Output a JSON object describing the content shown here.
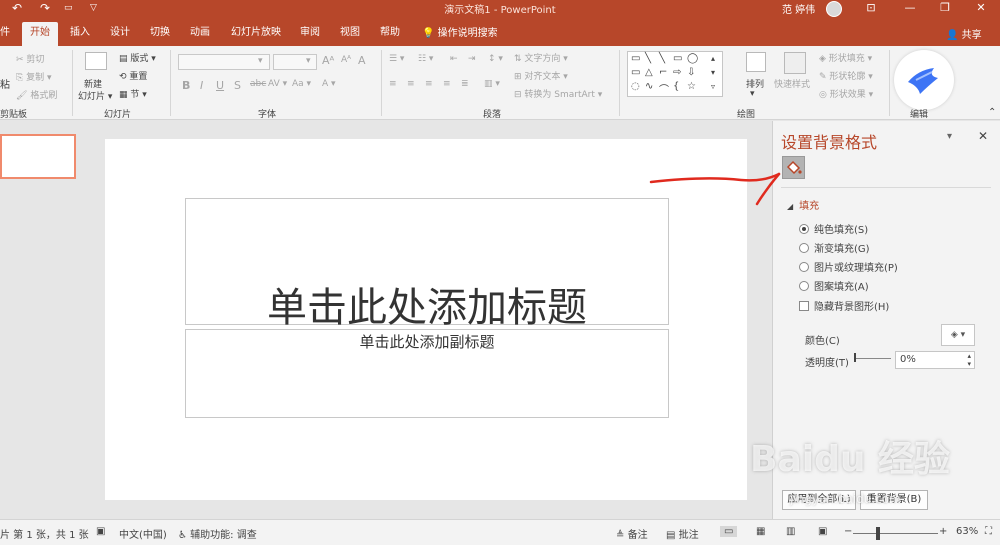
{
  "app": {
    "doc_title": "演示文稿1  -  PowerPoint",
    "user_name": "范 婷伟",
    "colors": {
      "accent": "#b7472a",
      "ribbon_bg": "#f3f3f3",
      "canvas_bg": "#e6e6e6"
    }
  },
  "quick_access": {
    "undo": "↶",
    "redo": "↷"
  },
  "window_controls": {
    "ribbon_display": "⊡",
    "minimize": "—",
    "restore": "❐",
    "close": "✕"
  },
  "tabs": [
    {
      "label": "件"
    },
    {
      "label": "开始"
    },
    {
      "label": "插入"
    },
    {
      "label": "设计"
    },
    {
      "label": "切换"
    },
    {
      "label": "动画"
    },
    {
      "label": "幻灯片放映"
    },
    {
      "label": "审阅"
    },
    {
      "label": "视图"
    },
    {
      "label": "帮助"
    }
  ],
  "search_tab": "操作说明搜索",
  "share_label": "共享",
  "ribbon": {
    "clipboard": {
      "paste": "粘",
      "cut": "剪切",
      "copy": "复制",
      "format_painter": "格式刷",
      "group": "剪贴板"
    },
    "slides": {
      "new_slide_1": "新建",
      "new_slide_2": "幻灯片 ▾",
      "layout": "版式 ▾",
      "reset": "重置",
      "section": "节 ▾",
      "group": "幻灯片"
    },
    "font": {
      "bold": "B",
      "italic": "I",
      "underline": "U",
      "shadow": "S",
      "strike": "abc",
      "spacing": "AV ▾",
      "case": "Aa ▾",
      "color": "A ▾",
      "grow": "Aᴬ",
      "shrink": "Aᴬ",
      "clear": "A",
      "group": "字体"
    },
    "paragraph": {
      "text_direction": "文字方向 ▾",
      "align_text": "对齐文本 ▾",
      "smartart": "转换为 SmartArt ▾",
      "group": "段落"
    },
    "drawing": {
      "arrange": "排列",
      "quick_styles": "快速样式",
      "shape_fill": "形状填充 ▾",
      "shape_outline": "形状轮廓 ▾",
      "shape_effects": "形状效果 ▾",
      "group": "绘图"
    },
    "editing": {
      "group": "编辑"
    }
  },
  "slide": {
    "title_placeholder": "单击此处添加标题",
    "subtitle_placeholder": "单击此处添加副标题"
  },
  "format_pane": {
    "title": "设置背景格式",
    "fill_section": "填充",
    "options": [
      {
        "label": "纯色填充(S)",
        "selected": true
      },
      {
        "label": "渐变填充(G)",
        "selected": false
      },
      {
        "label": "图片或纹理填充(P)",
        "selected": false
      },
      {
        "label": "图案填充(A)",
        "selected": false
      }
    ],
    "hide_bg_graphics": "隐藏背景图形(H)",
    "color_label": "颜色(C)",
    "transparency_label": "透明度(T)",
    "transparency_value": "0%",
    "apply_all": "应用到全部(L)",
    "reset_bg": "重置背景(B)"
  },
  "status_bar": {
    "slide_info": "片 第 1 张，共 1 张",
    "language": "中文(中国)",
    "accessibility": "辅助功能: 调查",
    "notes": "备注",
    "comments": "批注",
    "zoom": "63%"
  },
  "watermark": {
    "brand": "Baidu 经验",
    "url": "jingyan.baidu.com"
  }
}
